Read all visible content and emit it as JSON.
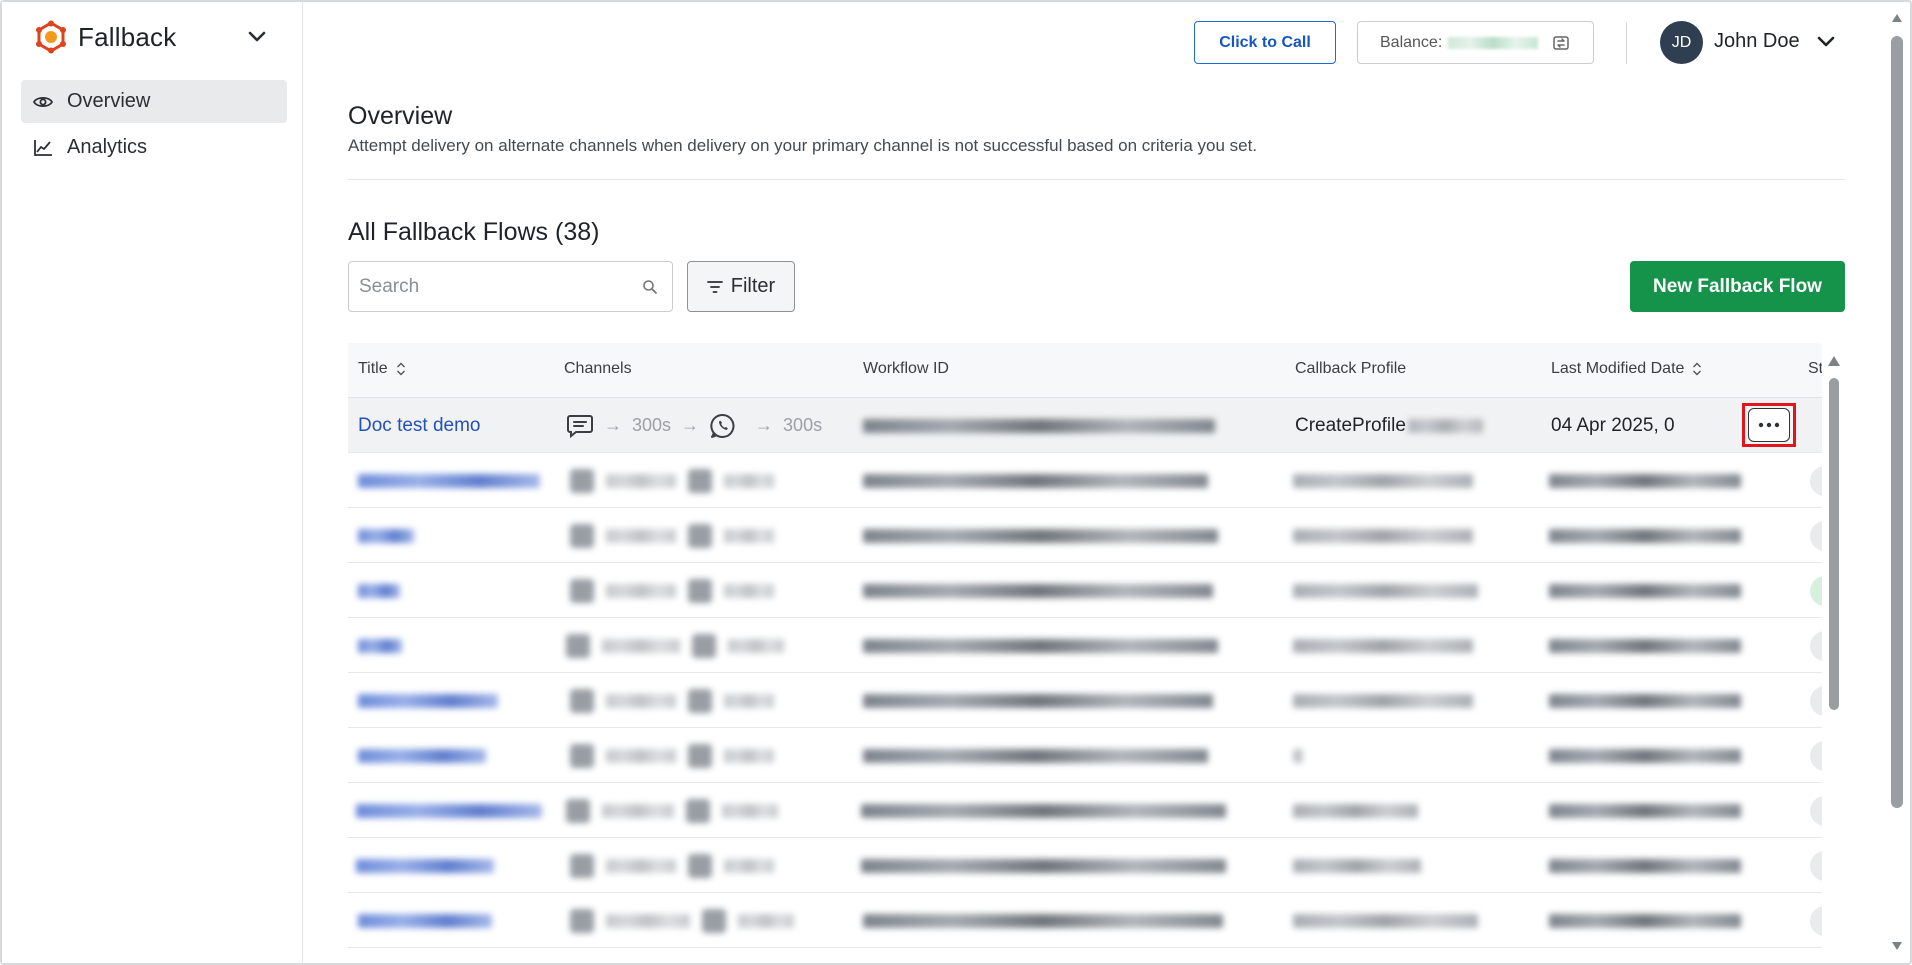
{
  "app": {
    "name": "Fallback"
  },
  "sidebar": {
    "items": [
      {
        "label": "Overview",
        "icon": "eye-icon",
        "active": true
      },
      {
        "label": "Analytics",
        "icon": "line-chart-icon",
        "active": false
      }
    ]
  },
  "header": {
    "click_to_call": "Click to Call",
    "balance_label": "Balance:",
    "user": {
      "initials": "JD",
      "name": "John Doe"
    }
  },
  "page": {
    "title": "Overview",
    "subtitle": "Attempt delivery on alternate channels when delivery on your primary channel is not successful based on criteria you set."
  },
  "flows": {
    "title": "All Fallback Flows (38)",
    "search_placeholder": "Search",
    "filter_label": "Filter",
    "new_button": "New Fallback Flow"
  },
  "table": {
    "columns": [
      "Title",
      "Channels",
      "Workflow ID",
      "Callback Profile",
      "Last Modified Date",
      "St"
    ],
    "first_row": {
      "title": "Doc test demo",
      "channels": [
        "sms-icon",
        "→",
        "300s",
        "→",
        "whatsapp-icon",
        "→",
        "300s"
      ],
      "delay1": "300s",
      "delay2": "300s",
      "callback_profile": "CreateProfile",
      "last_modified": "04 Apr 2025, 0"
    }
  },
  "colors": {
    "primary_button": "#16934b",
    "link": "#2451b7",
    "call_button": "#1557c0",
    "highlight": "#e0161c",
    "avatar": "#2f3e51"
  }
}
